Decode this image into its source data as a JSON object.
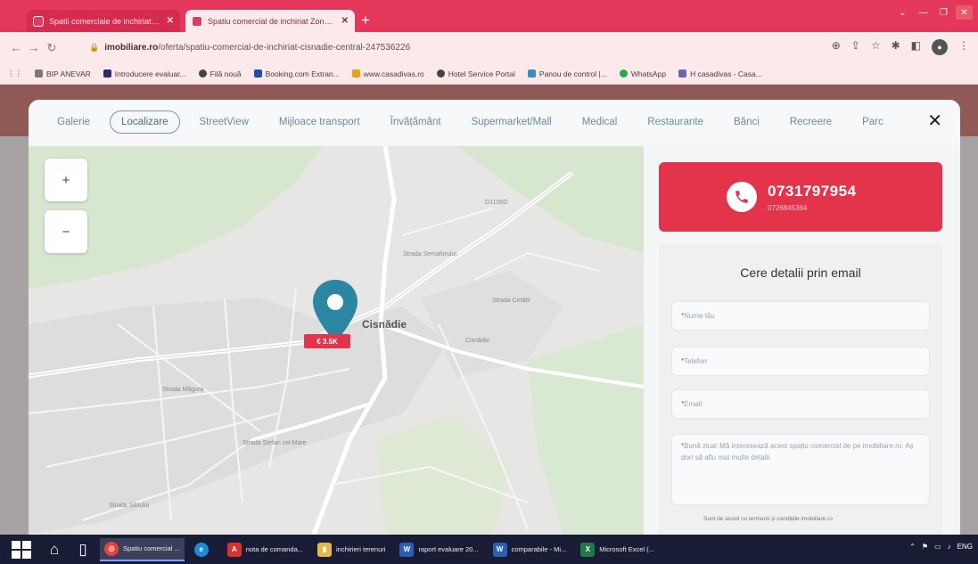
{
  "browser": {
    "tabs": [
      {
        "title": "Spatii comerciale de inchiriat in Cisnadie",
        "active": false
      },
      {
        "title": "Spatiu comercial de inchiriat Zona Centrala",
        "active": true
      }
    ],
    "new_tab_glyph": "+",
    "address": {
      "host": "imobiliare.ro",
      "path": "/oferta/spatiu-comercial-de-inchiriat-cisnadie-central-247536226"
    },
    "bookmarks": [
      {
        "label": "BIP ANEVAR"
      },
      {
        "label": "Introducere evaluar..."
      },
      {
        "label": "Filă nouă"
      },
      {
        "label": "Booking.com Extran..."
      },
      {
        "label": "www.casadivas.ro"
      },
      {
        "label": "Hotel Service Portal"
      },
      {
        "label": "Panou de control |..."
      },
      {
        "label": "WhatsApp"
      },
      {
        "label": "H casadivas - Casa..."
      }
    ]
  },
  "modal": {
    "tabs": [
      "Galerie",
      "Localizare",
      "StreetView",
      "Mijloace transport",
      "Învățământ",
      "Supermarket/Mall",
      "Medical",
      "Restaurante",
      "Bănci",
      "Recreere",
      "Parc"
    ],
    "active_tab": "Localizare",
    "close_glyph": "✕"
  },
  "map": {
    "zoom_in": "+",
    "zoom_out": "−",
    "price_tag": "€ 3.5K",
    "town_label": "Cisnădie",
    "street_labels": [
      "Strada Semaforului",
      "Strada Cetății",
      "Strada Măgura",
      "Cisnădie",
      "DJ106D",
      "Strada Ștefan cel Mare",
      "Strada Sibiului"
    ]
  },
  "contact": {
    "phone_main": "0731797954",
    "phone_alt": "0726845364",
    "email_title": "Cere detalii prin email",
    "fields": {
      "name": "Nume tău",
      "phone": "Telefon",
      "email": "Email",
      "message": "Bună ziua! Mă interesează acest spațiu comercial de pe imobiliare.ro. Aș dori să aflu mai multe detalii."
    },
    "required_mark": "*",
    "consent": "Sunt de acord cu termenii și condițiile imobiliare.ro"
  },
  "taskbar": {
    "items": [
      {
        "label": "Spatiu comercial ...",
        "icon": "chrome-icon",
        "active": true
      },
      {
        "label": "",
        "icon": "edge-icon",
        "active": false
      },
      {
        "label": "nota de comanda...",
        "icon": "pdf-icon",
        "active": false
      },
      {
        "label": "inchirieri terenuri",
        "icon": "folder-icon",
        "active": false
      },
      {
        "label": "raport evaluare 20...",
        "icon": "word-icon",
        "active": false
      },
      {
        "label": "comparabile - Mi...",
        "icon": "word-icon",
        "active": false
      },
      {
        "label": "Microsoft Excel (...",
        "icon": "excel-icon",
        "active": false
      }
    ],
    "tray_lang": "ENG"
  },
  "colors": {
    "accent": "#e3344c",
    "tabstrip": "#e4375a",
    "pin": "#2a86a3",
    "taskbar": "#181d35"
  }
}
